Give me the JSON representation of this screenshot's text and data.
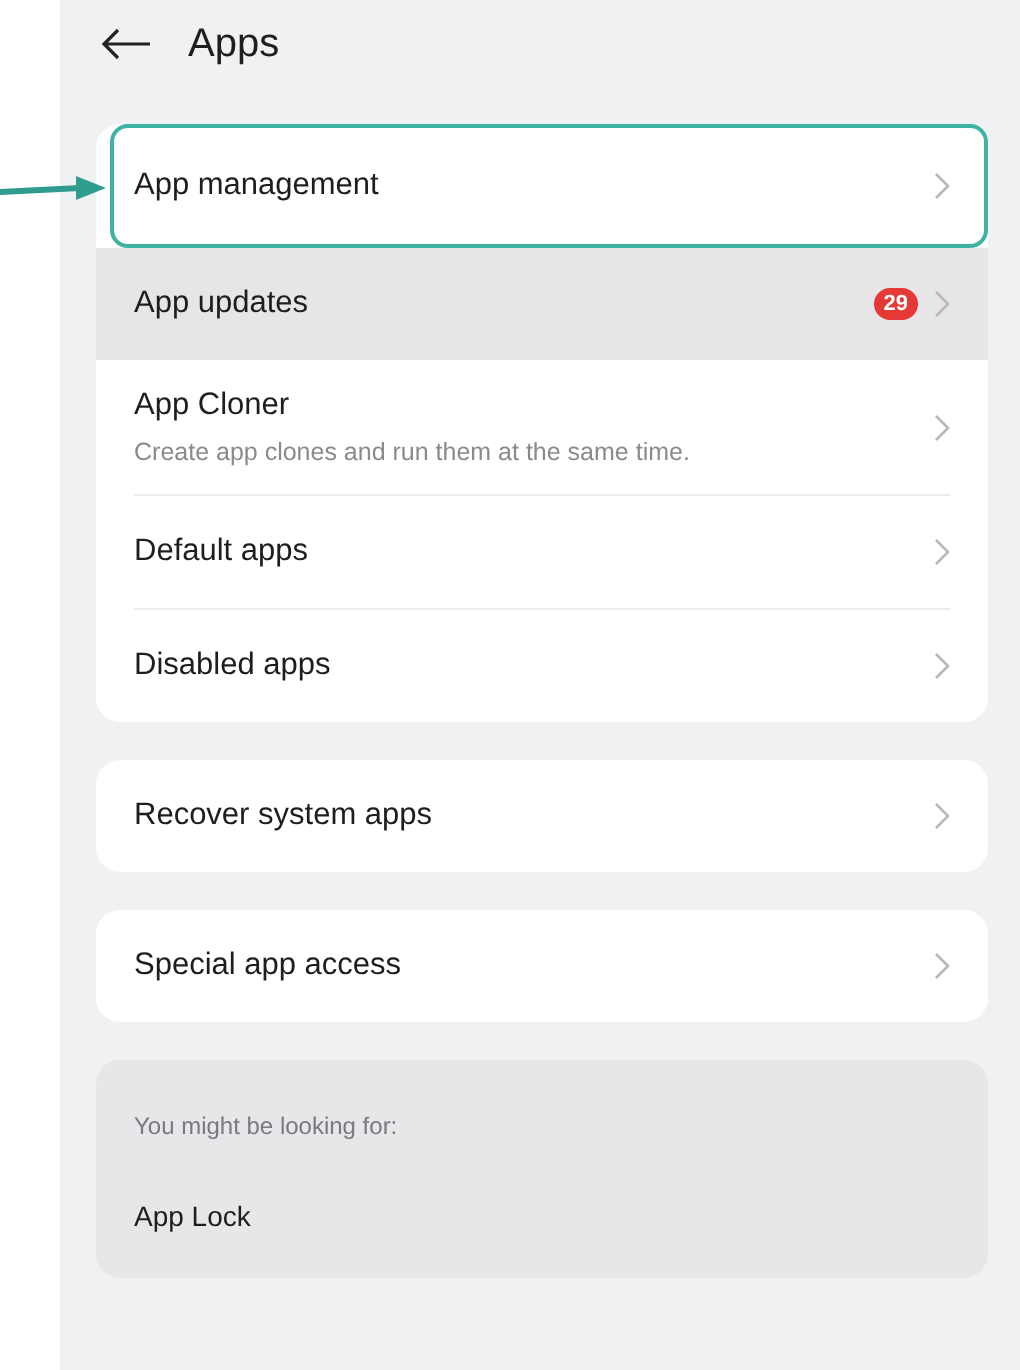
{
  "header": {
    "title": "Apps"
  },
  "groups": [
    {
      "items": [
        {
          "label": "App management",
          "highlighted": true,
          "pressed": false
        },
        {
          "label": "App updates",
          "badge": "29",
          "highlighted": false,
          "pressed": true
        },
        {
          "label": "App Cloner",
          "subtitle": "Create app clones and run them at the same time.",
          "highlighted": false,
          "pressed": false
        },
        {
          "label": "Default apps",
          "highlighted": false,
          "pressed": false
        },
        {
          "label": "Disabled apps",
          "highlighted": false,
          "pressed": false
        }
      ]
    },
    {
      "items": [
        {
          "label": "Recover system apps",
          "highlighted": false,
          "pressed": false
        }
      ]
    },
    {
      "items": [
        {
          "label": "Special app access",
          "highlighted": false,
          "pressed": false
        }
      ]
    }
  ],
  "suggestions": {
    "heading": "You might be looking for:",
    "items": [
      "App Lock"
    ]
  }
}
